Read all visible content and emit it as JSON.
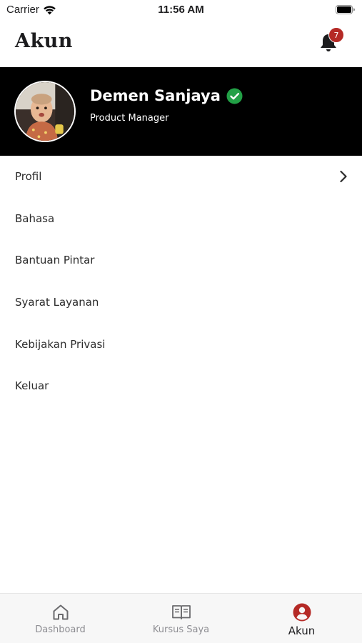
{
  "status_bar": {
    "carrier": "Carrier",
    "time": "11:56 AM",
    "icons": [
      "wifi-icon",
      "battery-icon"
    ]
  },
  "header": {
    "title": "Akun",
    "notification_icon": "bell-icon",
    "notification_count": "7",
    "badge_color": "#b52a26"
  },
  "profile": {
    "name": "Demen Sanjaya",
    "role": "Product Manager",
    "verified_icon": "check-circle-icon",
    "verified_color": "#22a046",
    "banner_color": "#000000"
  },
  "menu": {
    "items": [
      {
        "label": "Profil",
        "chevron": true
      },
      {
        "label": "Bahasa"
      },
      {
        "label": "Bantuan Pintar"
      },
      {
        "label": "Syarat Layanan"
      },
      {
        "label": "Kebijakan Privasi"
      },
      {
        "label": "Keluar"
      }
    ]
  },
  "tab_bar": {
    "tabs": [
      {
        "label": "Dashboard",
        "icon": "home-icon",
        "active": false
      },
      {
        "label": "Kursus Saya",
        "icon": "book-icon",
        "active": false
      },
      {
        "label": "Akun",
        "icon": "user-circle-icon",
        "active": true
      }
    ],
    "active_color": "#b52a26",
    "inactive_color": "#8e8e93"
  }
}
